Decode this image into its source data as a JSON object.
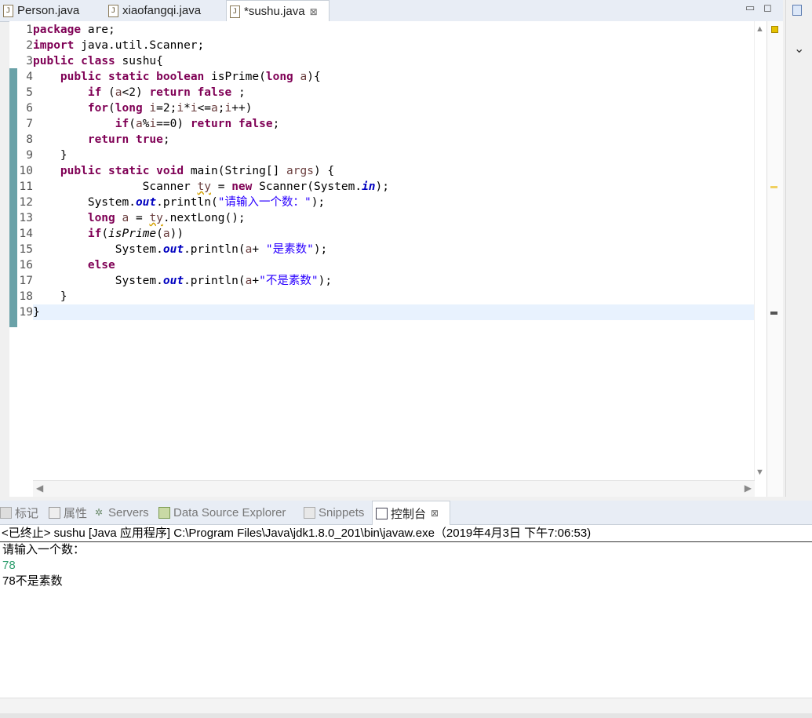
{
  "editor_tabs": [
    {
      "label": "Person.java",
      "active": false
    },
    {
      "label": "xiaofangqi.java",
      "active": false
    },
    {
      "label": "*sushu.java",
      "active": true
    }
  ],
  "line_numbers": [
    "1",
    "2",
    "3",
    "4",
    "5",
    "6",
    "7",
    "8",
    "9",
    "10",
    "11",
    "12",
    "13",
    "14",
    "15",
    "16",
    "17",
    "18",
    "19"
  ],
  "code_lines": [
    "package are;",
    "import java.util.Scanner;",
    "public class sushu{",
    "    public static boolean isPrime(long a){",
    "        if (a<2) return false ;",
    "        for(long i=2;i*i<=a;i++)",
    "            if(a%i==0) return false;",
    "        return true;",
    "    }",
    "    public static void main(String[] args) {",
    "                Scanner ty = new Scanner(System.in);",
    "        System.out.println(\"请输入一个数：\");",
    "        long a = ty.nextLong();",
    "        if(isPrime(a))",
    "            System.out.println(a+ \"是素数\");",
    "        else",
    "            System.out.println(a+\"不是素数\");",
    "    }",
    "}"
  ],
  "views_tabs": [
    {
      "label": "标记",
      "icon": "markers-icon",
      "active": false
    },
    {
      "label": "属性",
      "icon": "properties-icon",
      "active": false
    },
    {
      "label": "Servers",
      "icon": "servers-icon",
      "active": false
    },
    {
      "label": "Data Source Explorer",
      "icon": "data-source-icon",
      "active": false
    },
    {
      "label": "Snippets",
      "icon": "snippets-icon",
      "active": false
    },
    {
      "label": "控制台",
      "icon": "console-icon",
      "active": true
    }
  ],
  "console": {
    "header": "<已终止> sushu [Java 应用程序] C:\\Program Files\\Java\\jdk1.8.0_201\\bin\\javaw.exe（2019年4月3日 下午7:06:53)",
    "lines": [
      {
        "text": "请输入一个数：",
        "type": "output"
      },
      {
        "text": "78",
        "type": "input"
      },
      {
        "text": "78不是素数",
        "type": "output"
      }
    ]
  }
}
